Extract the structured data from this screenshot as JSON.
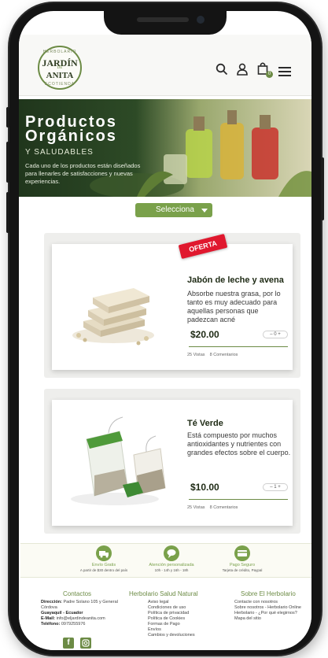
{
  "header": {
    "logo": {
      "top": "HERBOLARIO",
      "line1": "JARDÍN",
      "line2": "DE",
      "line3": "ANITA",
      "bottom": "ECOTIENDA"
    },
    "cart_count": "0"
  },
  "banner": {
    "title_line1": "Productos",
    "title_line2": "Orgánicos",
    "subtitle": "Y SALUDABLES",
    "description": "Cada uno de los productos están diseñados para llenarles de satisfacciones y nuevas experiencias."
  },
  "filter": {
    "label": "Selecciona"
  },
  "products": [
    {
      "badge": "OFERTA",
      "title": "Jabón de leche y avena",
      "description": "Absorbe nuestra grasa, por lo tanto es muy adecuado para aquellas personas que padezcan acné",
      "price": "$20.00",
      "qty": "0",
      "views": "25 Vistas",
      "comments": "8 Comentarios"
    },
    {
      "title": "Té Verde",
      "description": "Está compuesto por muchos antioxidantes y nutrientes con grandes efectos sobre el cuerpo.",
      "price": "$10.00",
      "qty": "1",
      "views": "25 Vistas",
      "comments": "8 Comentarios"
    }
  ],
  "benefits": [
    {
      "title": "Envío Gratis",
      "subtitle": "A partir de $30 dentro del país"
    },
    {
      "title": "Atención personalizada",
      "subtitle": "10h - 14h y 16h - 18h"
    },
    {
      "title": "Pago Seguro",
      "subtitle": "Tarjeta de crédito, Paypal"
    }
  ],
  "footer": {
    "contact": {
      "heading": "Contactos",
      "address_label": "Dirección:",
      "address": "Padre Solano 105 y General Córdova",
      "city": "Guayaquil - Ecuador",
      "email_label": "E-Mail:",
      "email": "info@eljardindeanita.com",
      "phone_label": "Teléfono:",
      "phone": "0979255976"
    },
    "herbolario": {
      "heading": "Herbolario Salud Natural",
      "links": [
        "Aviso legal",
        "Condiciones de uso",
        "Política de privacidad",
        "Política de Cookies",
        "Formas de Pago",
        "Envíos",
        "Cambios y devoluciones"
      ]
    },
    "about": {
      "heading": "Sobre El Herbolario",
      "links": [
        "Contacte con nosotros",
        "Sobre nosotros - Herbolario Online",
        "Herbolario - ¿Por qué elegirnos?",
        "Mapa del sitio"
      ]
    }
  },
  "colors": {
    "brand_green": "#6c8b45",
    "accent_green": "#7aa14b",
    "offer_red": "#e0182e"
  }
}
